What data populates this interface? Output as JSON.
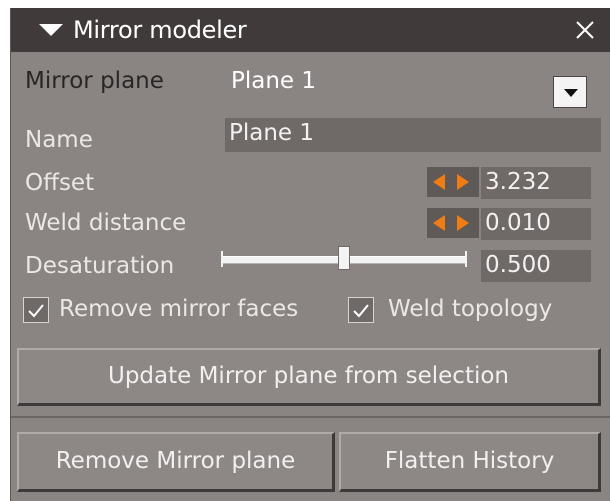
{
  "panel": {
    "title": "Mirror modeler",
    "colors": {
      "title_bg": "#403b3a",
      "panel_bg": "#8a8482",
      "field_bg": "#6f6968",
      "spinner_accent": "#f07c14"
    }
  },
  "mirror_plane": {
    "label": "Mirror plane",
    "selected": "Plane 1"
  },
  "fields": {
    "name": {
      "label": "Name",
      "value": "Plane 1"
    },
    "offset": {
      "label": "Offset",
      "value": "3.232"
    },
    "weld_distance": {
      "label": "Weld distance",
      "value": "0.010"
    },
    "desaturation": {
      "label": "Desaturation",
      "value": "0.500",
      "slider_fraction": 0.5
    }
  },
  "options": {
    "remove_mirror_faces": {
      "label": "Remove mirror faces",
      "checked": true
    },
    "weld_topology": {
      "label": "Weld topology",
      "checked": true
    }
  },
  "buttons": {
    "update": "Update Mirror plane from selection",
    "remove": "Remove Mirror plane",
    "flatten": "Flatten History"
  },
  "icons": {
    "collapse": "collapse-arrow-icon",
    "close": "close-icon",
    "dropdown": "chevron-down-icon",
    "spinner_left": "arrow-left-icon",
    "spinner_right": "arrow-right-icon",
    "check": "check-icon"
  }
}
